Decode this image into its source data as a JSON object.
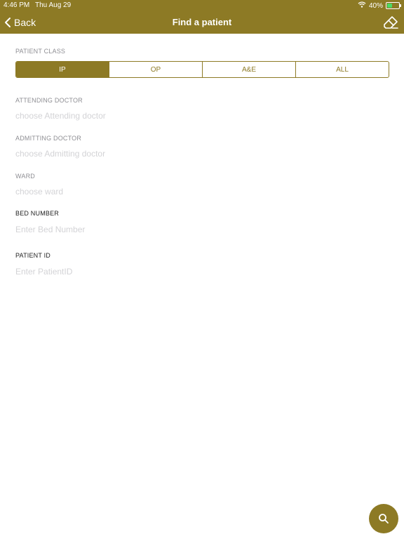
{
  "status_bar": {
    "time": "4:46 PM",
    "date": "Thu Aug 29",
    "battery_text": "40%",
    "battery_level": 0.4
  },
  "navbar": {
    "back_label": "Back",
    "title": "Find a patient"
  },
  "patient_class": {
    "label": "PATIENT CLASS",
    "options": [
      "IP",
      "OP",
      "A&E",
      "ALL"
    ],
    "selected": "IP"
  },
  "fields": {
    "attending_doctor": {
      "label": "ATTENDING DOCTOR",
      "placeholder": "choose Attending doctor"
    },
    "admitting_doctor": {
      "label": "ADMITTING DOCTOR",
      "placeholder": "choose Admitting doctor"
    },
    "ward": {
      "label": "WARD",
      "placeholder": "choose ward"
    },
    "bed_number": {
      "label": "BED NUMBER",
      "placeholder": "Enter Bed Number"
    },
    "patient_id": {
      "label": "PATIENT ID",
      "placeholder": "Enter PatientID"
    }
  },
  "colors": {
    "accent": "#8d7a25",
    "muted_label": "#8e8e93",
    "placeholder": "#d3d3d6"
  },
  "icons": {
    "back": "chevron-left-icon",
    "clear": "eraser-icon",
    "search": "search-icon",
    "wifi": "wifi-icon",
    "battery": "battery-icon"
  }
}
